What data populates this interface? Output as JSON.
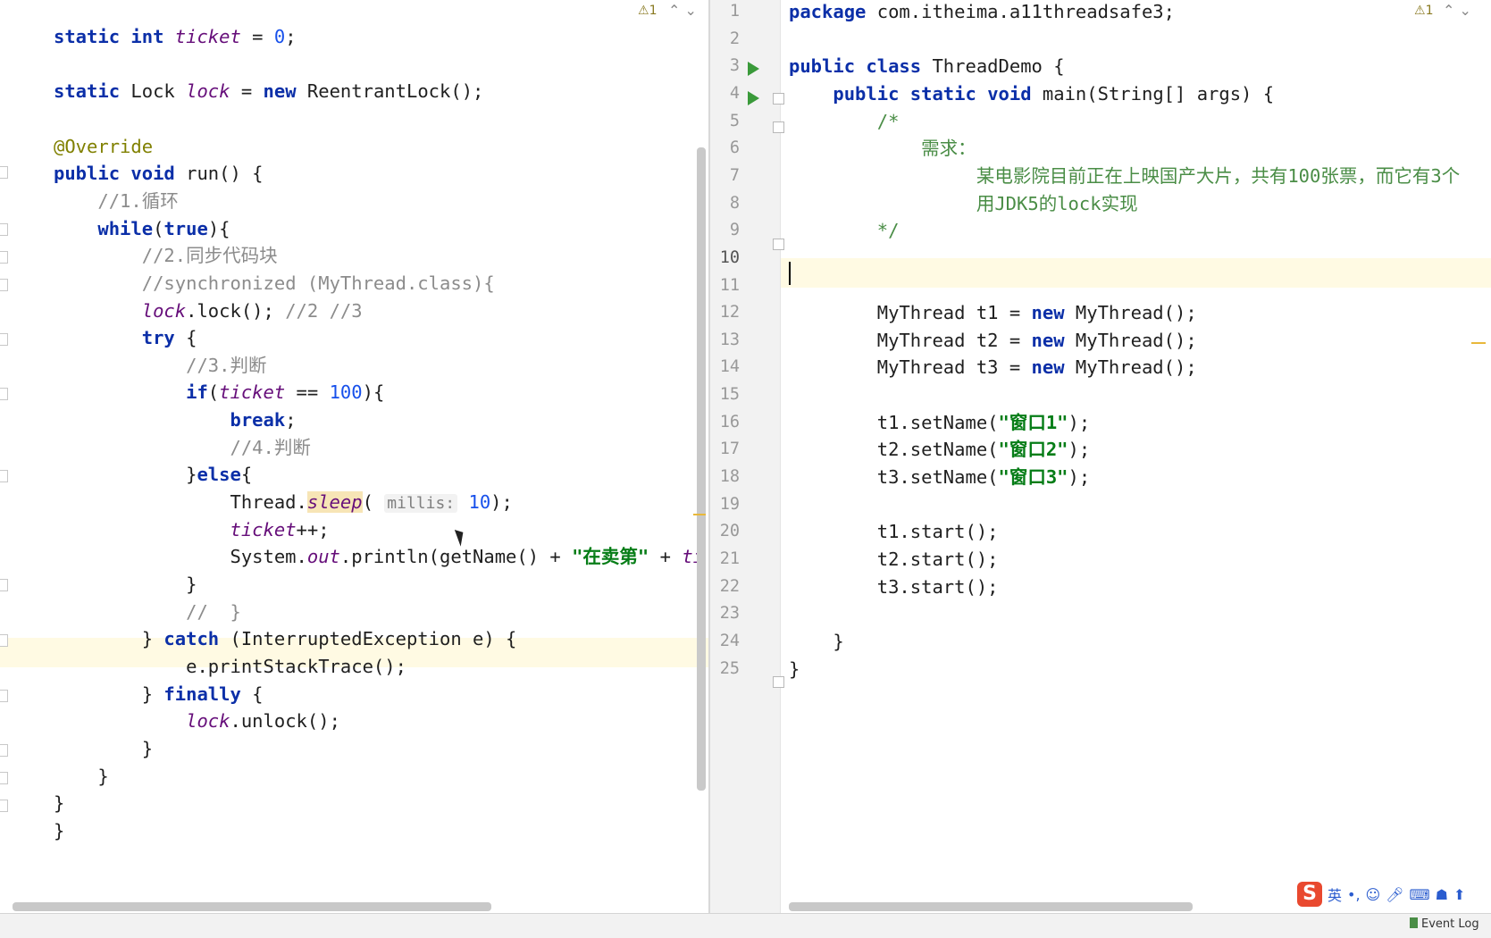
{
  "left_editor": {
    "warning_count": "1",
    "lines": [
      [
        {
          "t": "static",
          "c": "kw"
        },
        {
          "t": " "
        },
        {
          "t": "int",
          "c": "kw"
        },
        {
          "t": " "
        },
        {
          "t": "ticket",
          "c": "fld"
        },
        {
          "t": " = "
        },
        {
          "t": "0",
          "c": "num"
        },
        {
          "t": ";"
        }
      ],
      [],
      [
        {
          "t": "static",
          "c": "kw"
        },
        {
          "t": " Lock "
        },
        {
          "t": "lock",
          "c": "fld"
        },
        {
          "t": " = "
        },
        {
          "t": "new",
          "c": "kw"
        },
        {
          "t": " ReentrantLock();"
        }
      ],
      [],
      [
        {
          "t": "@Override",
          "c": "an"
        }
      ],
      [
        {
          "t": "public",
          "c": "kw"
        },
        {
          "t": " "
        },
        {
          "t": "void",
          "c": "kw"
        },
        {
          "t": " run() {"
        }
      ],
      [
        {
          "t": "    "
        },
        {
          "t": "//1.循环",
          "c": "cm"
        }
      ],
      [
        {
          "t": "    "
        },
        {
          "t": "while",
          "c": "kw"
        },
        {
          "t": "("
        },
        {
          "t": "true",
          "c": "kw"
        },
        {
          "t": "){"
        }
      ],
      [
        {
          "t": "        "
        },
        {
          "t": "//2.同步代码块",
          "c": "cm"
        }
      ],
      [
        {
          "t": "        "
        },
        {
          "t": "//synchronized (MyThread.class){",
          "c": "cm"
        }
      ],
      [
        {
          "t": "        "
        },
        {
          "t": "lock",
          "c": "fld"
        },
        {
          "t": ".lock(); "
        },
        {
          "t": "//2 //3",
          "c": "cm"
        }
      ],
      [
        {
          "t": "        "
        },
        {
          "t": "try",
          "c": "kw"
        },
        {
          "t": " {"
        }
      ],
      [
        {
          "t": "            "
        },
        {
          "t": "//3.判断",
          "c": "cm"
        }
      ],
      [
        {
          "t": "            "
        },
        {
          "t": "if",
          "c": "kw"
        },
        {
          "t": "("
        },
        {
          "t": "ticket",
          "c": "fld"
        },
        {
          "t": " == "
        },
        {
          "t": "100",
          "c": "num"
        },
        {
          "t": "){"
        }
      ],
      [
        {
          "t": "                "
        },
        {
          "t": "break",
          "c": "kw"
        },
        {
          "t": ";"
        }
      ],
      [
        {
          "t": "                "
        },
        {
          "t": "//4.判断",
          "c": "cm"
        }
      ],
      [
        {
          "t": "            }"
        },
        {
          "t": "else",
          "c": "kw"
        },
        {
          "t": "{"
        }
      ],
      [
        {
          "t": "                Thread."
        },
        {
          "t": "sleep",
          "c": "it hl-sleep"
        },
        {
          "t": "( "
        },
        {
          "t": "millis:",
          "c": "hint"
        },
        {
          "t": " "
        },
        {
          "t": "10",
          "c": "num"
        },
        {
          "t": ");"
        }
      ],
      [
        {
          "t": "                "
        },
        {
          "t": "ticket",
          "c": "fld"
        },
        {
          "t": "++;"
        }
      ],
      [
        {
          "t": "                System."
        },
        {
          "t": "out",
          "c": "fld"
        },
        {
          "t": ".println(getName() + "
        },
        {
          "t": "\"在卖第\"",
          "c": "st"
        },
        {
          "t": " + "
        },
        {
          "t": "ti",
          "c": "fld"
        }
      ],
      [
        {
          "t": "            }"
        }
      ],
      [
        {
          "t": "            "
        },
        {
          "t": "//  }",
          "c": "cm"
        }
      ],
      [
        {
          "t": "        } "
        },
        {
          "t": "catch",
          "c": "kw"
        },
        {
          "t": " (InterruptedException e) {"
        }
      ],
      [
        {
          "t": "            e.printStackTrace();"
        }
      ],
      [
        {
          "t": "        } "
        },
        {
          "t": "finally",
          "c": "kw"
        },
        {
          "t": " {"
        }
      ],
      [
        {
          "t": "            "
        },
        {
          "t": "lock",
          "c": "fld"
        },
        {
          "t": ".unlock();"
        }
      ],
      [
        {
          "t": "        }"
        }
      ],
      [
        {
          "t": "    }"
        }
      ],
      [
        {
          "t": "}"
        }
      ],
      [
        {
          "t": "}"
        }
      ]
    ]
  },
  "right_editor": {
    "warning_count": "1",
    "line_numbers": [
      "1",
      "2",
      "3",
      "4",
      "5",
      "6",
      "7",
      "8",
      "9",
      "10",
      "11",
      "12",
      "13",
      "14",
      "15",
      "16",
      "17",
      "18",
      "19",
      "20",
      "21",
      "22",
      "23",
      "24",
      "25"
    ],
    "lines": [
      [
        {
          "t": "package",
          "c": "kw"
        },
        {
          "t": " com.itheima.a11threadsafe3;"
        }
      ],
      [],
      [
        {
          "t": "public",
          "c": "kw"
        },
        {
          "t": " "
        },
        {
          "t": "class",
          "c": "kw"
        },
        {
          "t": " ThreadDemo {"
        }
      ],
      [
        {
          "t": "    "
        },
        {
          "t": "public",
          "c": "kw"
        },
        {
          "t": " "
        },
        {
          "t": "static",
          "c": "kw"
        },
        {
          "t": " "
        },
        {
          "t": "void",
          "c": "kw"
        },
        {
          "t": " main(String[] args) {"
        }
      ],
      [
        {
          "t": "        "
        },
        {
          "t": "/*",
          "c": "doc"
        }
      ],
      [
        {
          "t": "            "
        },
        {
          "t": "需求：",
          "c": "doc"
        }
      ],
      [
        {
          "t": "                 "
        },
        {
          "t": "某电影院目前正在上映国产大片，共有100张票，而它有3个",
          "c": "doc"
        }
      ],
      [
        {
          "t": "                 "
        },
        {
          "t": "用JDK5的lock实现",
          "c": "doc"
        }
      ],
      [
        {
          "t": "        "
        },
        {
          "t": "*/",
          "c": "doc"
        }
      ],
      [],
      [],
      [
        {
          "t": "        MyThread t1 = "
        },
        {
          "t": "new",
          "c": "kw"
        },
        {
          "t": " MyThread();"
        }
      ],
      [
        {
          "t": "        MyThread t2 = "
        },
        {
          "t": "new",
          "c": "kw"
        },
        {
          "t": " MyThread();"
        }
      ],
      [
        {
          "t": "        MyThread t3 = "
        },
        {
          "t": "new",
          "c": "kw"
        },
        {
          "t": " MyThread();"
        }
      ],
      [],
      [
        {
          "t": "        t1.setName("
        },
        {
          "t": "\"窗口1\"",
          "c": "st"
        },
        {
          "t": ");"
        }
      ],
      [
        {
          "t": "        t2.setName("
        },
        {
          "t": "\"窗口2\"",
          "c": "st"
        },
        {
          "t": ");"
        }
      ],
      [
        {
          "t": "        t3.setName("
        },
        {
          "t": "\"窗口3\"",
          "c": "st"
        },
        {
          "t": ");"
        }
      ],
      [],
      [
        {
          "t": "        t1.start();"
        }
      ],
      [
        {
          "t": "        t2.start();"
        }
      ],
      [
        {
          "t": "        t3.start();"
        }
      ],
      [],
      [
        {
          "t": "    }"
        }
      ],
      [
        {
          "t": "}"
        }
      ]
    ]
  },
  "ime_toolbar": {
    "logo": "S",
    "lang": "英",
    "items": [
      "punctuation-icon",
      "emoji-icon",
      "microphone-icon",
      "keyboard-icon",
      "user-icon",
      "skin-icon"
    ]
  },
  "status_bar": {
    "event_log": "Event Log"
  }
}
